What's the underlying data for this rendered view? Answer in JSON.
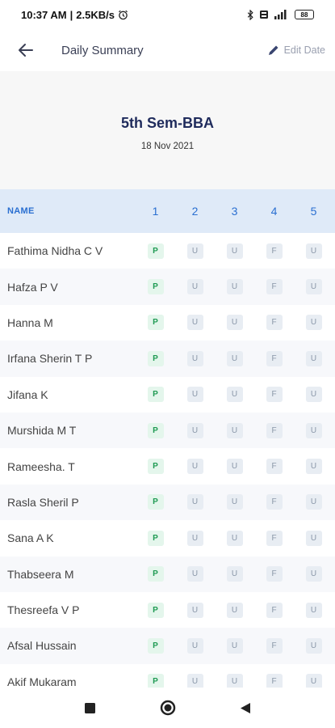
{
  "status_bar": {
    "time": "10:37 AM",
    "speed": "2.5KB/s",
    "battery": "88"
  },
  "app_bar": {
    "title": "Daily Summary",
    "edit_label": "Edit Date"
  },
  "summary": {
    "class_name": "5th Sem-BBA",
    "date": "18 Nov 2021"
  },
  "table": {
    "name_header": "NAME",
    "periods": [
      "1",
      "2",
      "3",
      "4",
      "5"
    ],
    "rows": [
      {
        "name": "Fathima Nidha C V",
        "marks": [
          "P",
          "U",
          "U",
          "F",
          "U"
        ]
      },
      {
        "name": "Hafza P V",
        "marks": [
          "P",
          "U",
          "U",
          "F",
          "U"
        ]
      },
      {
        "name": "Hanna M",
        "marks": [
          "P",
          "U",
          "U",
          "F",
          "U"
        ]
      },
      {
        "name": "Irfana Sherin T P",
        "marks": [
          "P",
          "U",
          "U",
          "F",
          "U"
        ]
      },
      {
        "name": "Jifana K",
        "marks": [
          "P",
          "U",
          "U",
          "F",
          "U"
        ]
      },
      {
        "name": "Murshida M T",
        "marks": [
          "P",
          "U",
          "U",
          "F",
          "U"
        ]
      },
      {
        "name": "Rameesha. T",
        "marks": [
          "P",
          "U",
          "U",
          "F",
          "U"
        ]
      },
      {
        "name": "Rasla Sheril P",
        "marks": [
          "P",
          "U",
          "U",
          "F",
          "U"
        ]
      },
      {
        "name": "Sana A K",
        "marks": [
          "P",
          "U",
          "U",
          "F",
          "U"
        ]
      },
      {
        "name": "Thabseera M",
        "marks": [
          "P",
          "U",
          "U",
          "F",
          "U"
        ]
      },
      {
        "name": "Thesreefa V P",
        "marks": [
          "P",
          "U",
          "U",
          "F",
          "U"
        ]
      },
      {
        "name": "Afsal Hussain",
        "marks": [
          "P",
          "U",
          "U",
          "F",
          "U"
        ]
      },
      {
        "name": "Akif Mukaram",
        "marks": [
          "P",
          "U",
          "U",
          "F",
          "U"
        ]
      }
    ]
  },
  "colors": {
    "accent": "#2a6fd1",
    "title": "#1f2b5c",
    "present": "#1e9a52",
    "header_bg": "#dfeaf8"
  },
  "icons": {
    "back": "arrow-left-icon",
    "edit": "pencil-icon",
    "nav_recent": "square-icon",
    "nav_home": "circle-icon",
    "nav_back": "triangle-left-icon"
  }
}
